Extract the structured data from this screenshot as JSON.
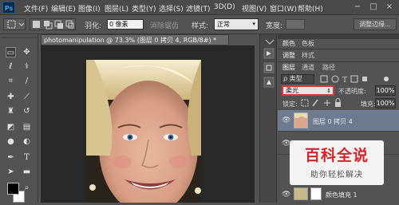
{
  "app": {
    "logo": "Ps"
  },
  "menu": [
    "文件(F)",
    "编辑(E)",
    "图像(I)",
    "图层(L)",
    "类型(Y)",
    "选择(S)",
    "滤镜(T)",
    "3D(D)",
    "视图(V)",
    "窗口(W)",
    "帮助(H)"
  ],
  "window_controls": [
    "−",
    "□",
    "×"
  ],
  "options": {
    "feather_label": "羽化:",
    "feather_value": "0 像素",
    "antialias_label": "消除锯齿",
    "style_label": "样式:",
    "style_value": "正常",
    "width_label": "宽度:",
    "refine_edge": "调整边缘..."
  },
  "document": {
    "tab_title": "photomanipulation @ 73.3% (图层 0 拷贝 4, RGB/8#) *",
    "close": "×"
  },
  "panels": {
    "top_tabs_1": [
      "颜色",
      "色板"
    ],
    "top_tabs_2": [
      "调整",
      "样式"
    ],
    "layer_tabs": [
      "图层",
      "通道",
      "路径"
    ],
    "kind_label": "ρ 类型",
    "blend_mode": "柔光",
    "opacity_label": "不透明度:",
    "opacity_value": "100%",
    "lock_label": "锁定:",
    "fill_label": "填充:",
    "fill_value": "100%",
    "layers": [
      {
        "name": "图层 0 拷贝 4"
      },
      {
        "name": "颜色填充 1"
      }
    ]
  },
  "watermark": {
    "title": "百科全说",
    "subtitle": "助你轻松解决"
  },
  "colors": {
    "accent": "#d83a3a",
    "selected_layer": "#6e7b8f",
    "foreground": "#000000",
    "background": "#ffffff"
  },
  "icons": [
    "marquee-icon",
    "move-icon",
    "lasso-icon",
    "magic-wand-icon",
    "crop-icon",
    "eyedropper-icon",
    "healing-brush-icon",
    "brush-icon",
    "clone-stamp-icon",
    "history-brush-icon",
    "eraser-icon",
    "gradient-icon",
    "blur-icon",
    "dodge-icon",
    "pen-icon",
    "type-icon",
    "path-select-icon",
    "shape-icon",
    "hand-icon",
    "zoom-icon",
    "eye-icon",
    "lock-icon",
    "link-icon"
  ]
}
